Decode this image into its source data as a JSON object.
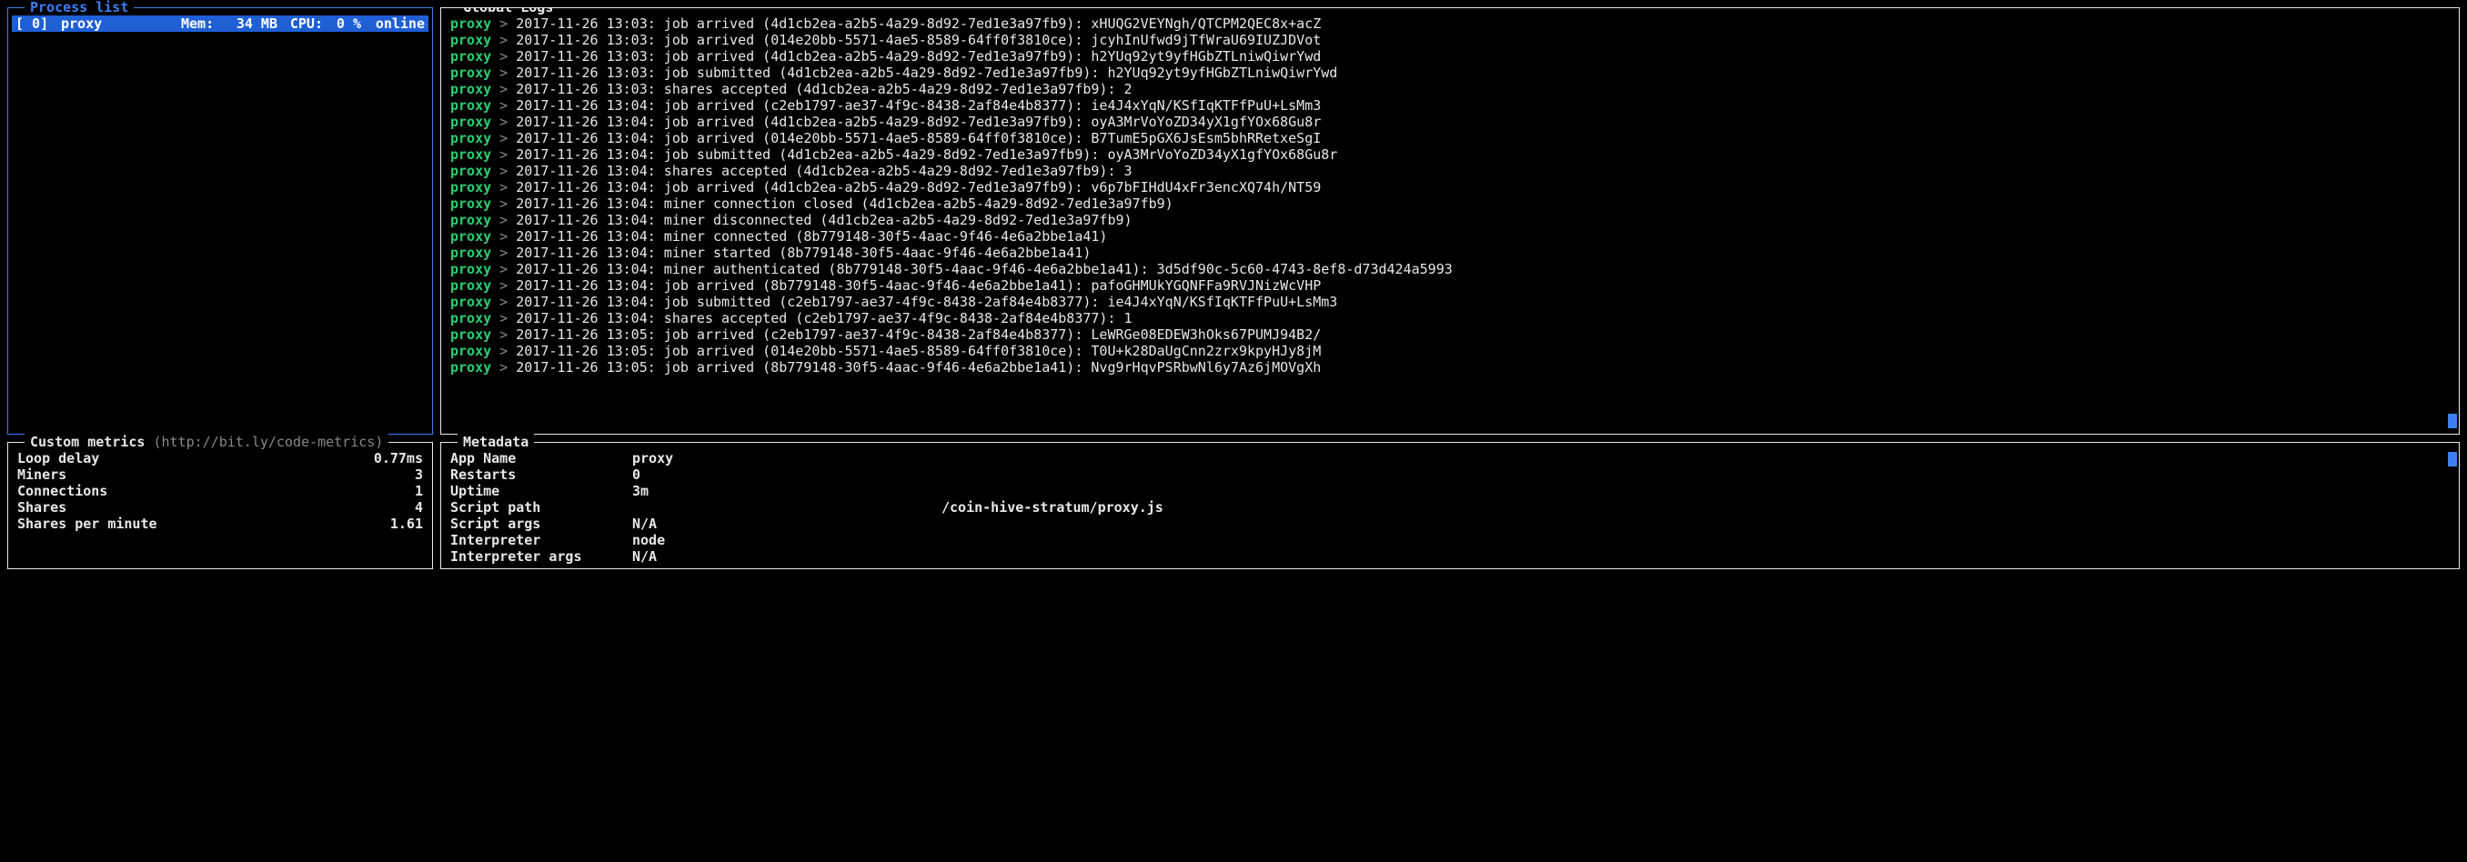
{
  "process_list": {
    "title": "Process list",
    "row": {
      "id": "[ 0]",
      "name": "proxy",
      "mem_label": "Mem:",
      "mem": "34 MB",
      "cpu_label": "CPU:",
      "cpu": "0 %",
      "status": "online"
    }
  },
  "global_logs": {
    "title": "Global Logs",
    "lines": [
      {
        "src": "proxy",
        "body": "2017-11-26 13:03: job arrived (4d1cb2ea-a2b5-4a29-8d92-7ed1e3a97fb9): xHUQG2VEYNgh/QTCPM2QEC8x+acZ"
      },
      {
        "src": "proxy",
        "body": "2017-11-26 13:03: job arrived (014e20bb-5571-4ae5-8589-64ff0f3810ce): jcyhInUfwd9jTfWraU69IUZJDVot"
      },
      {
        "src": "proxy",
        "body": "2017-11-26 13:03: job arrived (4d1cb2ea-a2b5-4a29-8d92-7ed1e3a97fb9): h2YUq92yt9yfHGbZTLniwQiwrYwd"
      },
      {
        "src": "proxy",
        "body": "2017-11-26 13:03: job submitted (4d1cb2ea-a2b5-4a29-8d92-7ed1e3a97fb9): h2YUq92yt9yfHGbZTLniwQiwrYwd"
      },
      {
        "src": "proxy",
        "body": "2017-11-26 13:03: shares accepted (4d1cb2ea-a2b5-4a29-8d92-7ed1e3a97fb9): 2"
      },
      {
        "src": "proxy",
        "body": "2017-11-26 13:04: job arrived (c2eb1797-ae37-4f9c-8438-2af84e4b8377): ie4J4xYqN/KSfIqKTFfPuU+LsMm3"
      },
      {
        "src": "proxy",
        "body": "2017-11-26 13:04: job arrived (4d1cb2ea-a2b5-4a29-8d92-7ed1e3a97fb9): oyA3MrVoYoZD34yX1gfYOx68Gu8r"
      },
      {
        "src": "proxy",
        "body": "2017-11-26 13:04: job arrived (014e20bb-5571-4ae5-8589-64ff0f3810ce): B7TumE5pGX6JsEsm5bhRRetxeSgI"
      },
      {
        "src": "proxy",
        "body": "2017-11-26 13:04: job submitted (4d1cb2ea-a2b5-4a29-8d92-7ed1e3a97fb9): oyA3MrVoYoZD34yX1gfYOx68Gu8r"
      },
      {
        "src": "proxy",
        "body": "2017-11-26 13:04: shares accepted (4d1cb2ea-a2b5-4a29-8d92-7ed1e3a97fb9): 3"
      },
      {
        "src": "proxy",
        "body": "2017-11-26 13:04: job arrived (4d1cb2ea-a2b5-4a29-8d92-7ed1e3a97fb9): v6p7bFIHdU4xFr3encXQ74h/NT59"
      },
      {
        "src": "proxy",
        "body": "2017-11-26 13:04: miner connection closed (4d1cb2ea-a2b5-4a29-8d92-7ed1e3a97fb9)"
      },
      {
        "src": "proxy",
        "body": "2017-11-26 13:04: miner disconnected (4d1cb2ea-a2b5-4a29-8d92-7ed1e3a97fb9)"
      },
      {
        "src": "proxy",
        "body": "2017-11-26 13:04: miner connected (8b779148-30f5-4aac-9f46-4e6a2bbe1a41)"
      },
      {
        "src": "proxy",
        "body": "2017-11-26 13:04: miner started (8b779148-30f5-4aac-9f46-4e6a2bbe1a41)"
      },
      {
        "src": "proxy",
        "body": "2017-11-26 13:04: miner authenticated (8b779148-30f5-4aac-9f46-4e6a2bbe1a41): 3d5df90c-5c60-4743-8ef8-d73d424a5993"
      },
      {
        "src": "proxy",
        "body": "2017-11-26 13:04: job arrived (8b779148-30f5-4aac-9f46-4e6a2bbe1a41): pafoGHMUkYGQNFFa9RVJNizWcVHP"
      },
      {
        "src": "proxy",
        "body": "2017-11-26 13:04: job submitted (c2eb1797-ae37-4f9c-8438-2af84e4b8377): ie4J4xYqN/KSfIqKTFfPuU+LsMm3"
      },
      {
        "src": "proxy",
        "body": "2017-11-26 13:04: shares accepted (c2eb1797-ae37-4f9c-8438-2af84e4b8377): 1"
      },
      {
        "src": "proxy",
        "body": "2017-11-26 13:05: job arrived (c2eb1797-ae37-4f9c-8438-2af84e4b8377): LeWRGe08EDEW3hOks67PUMJ94B2/"
      },
      {
        "src": "proxy",
        "body": "2017-11-26 13:05: job arrived (014e20bb-5571-4ae5-8589-64ff0f3810ce): T0U+k28DaUgCnn2zrx9kpyHJy8jM"
      },
      {
        "src": "proxy",
        "body": "2017-11-26 13:05: job arrived (8b779148-30f5-4aac-9f46-4e6a2bbe1a41): Nvg9rHqvPSRbwNl6y7Az6jMOVgXh"
      }
    ]
  },
  "custom_metrics": {
    "title": "Custom metrics",
    "hint": "(http://bit.ly/code-metrics)",
    "rows": [
      {
        "k": "Loop delay",
        "v": "0.77ms"
      },
      {
        "k": "Miners",
        "v": "3"
      },
      {
        "k": "Connections",
        "v": "1"
      },
      {
        "k": "Shares",
        "v": "4"
      },
      {
        "k": "Shares per minute",
        "v": "1.61"
      }
    ]
  },
  "metadata": {
    "title": "Metadata",
    "rows": [
      {
        "k": "App Name",
        "v": "proxy"
      },
      {
        "k": "Restarts",
        "v": "0"
      },
      {
        "k": "Uptime",
        "v": "3m"
      },
      {
        "k": "Script path",
        "v": "/coin-hive-stratum/proxy.js",
        "redacted": true
      },
      {
        "k": "Script args",
        "v": "N/A"
      },
      {
        "k": "Interpreter",
        "v": "node"
      },
      {
        "k": "Interpreter args",
        "v": "N/A"
      }
    ]
  }
}
